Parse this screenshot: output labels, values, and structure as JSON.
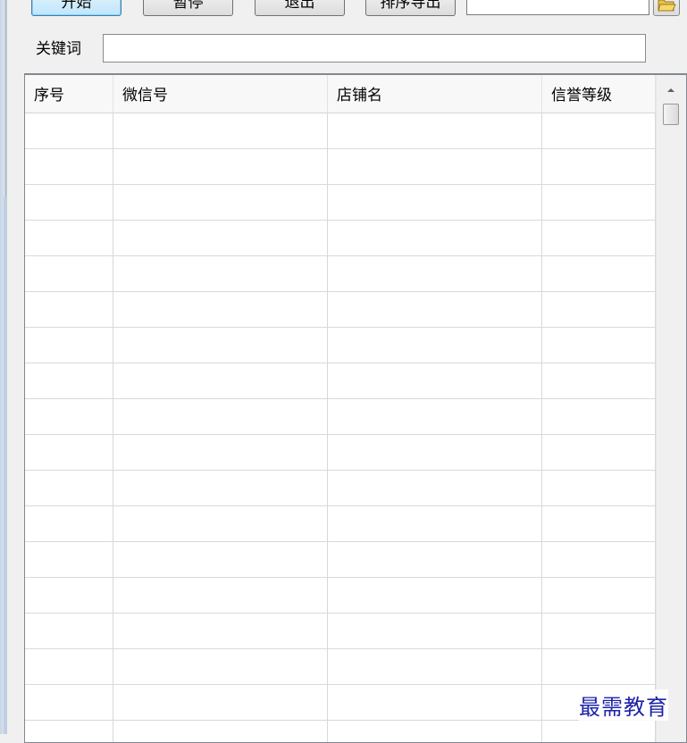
{
  "toolbar": {
    "start_label": "开始",
    "pause_label": "暂停",
    "exit_label": "退出",
    "export_label": "排序导出",
    "path_value": ""
  },
  "keyword": {
    "label": "关键词",
    "value": ""
  },
  "table": {
    "columns": [
      "序号",
      "微信号",
      "店铺名",
      "信誉等级"
    ],
    "row_count": 18,
    "rows": []
  },
  "watermark": "最需教育",
  "icons": {
    "folder": "folder-icon",
    "scroll_up": "scroll-up-arrow-icon"
  }
}
